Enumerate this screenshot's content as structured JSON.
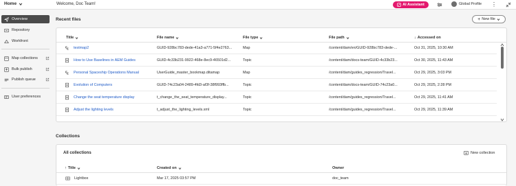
{
  "topbar": {
    "home_label": "Home",
    "welcome": "Welcome, Doc Team!",
    "ai_assistant": "AI Assistant",
    "profile": "Global Profile"
  },
  "sidebar": {
    "items": [
      {
        "label": "Overview",
        "icon": "overview-icon"
      },
      {
        "label": "Repository",
        "icon": "repository-icon"
      },
      {
        "label": "Workfront",
        "icon": "workfront-icon"
      },
      {
        "label": "Map collections",
        "icon": "map-collections-icon"
      },
      {
        "label": "Bulk publish",
        "icon": "bulk-publish-icon"
      },
      {
        "label": "Publish queue",
        "icon": "publish-queue-icon"
      },
      {
        "label": "User preferences",
        "icon": "user-preferences-icon"
      }
    ]
  },
  "recent": {
    "title": "Recent files",
    "new_file": "New file",
    "columns": {
      "title": "Title",
      "file_name": "File name",
      "file_type": "File type",
      "file_path": "File path",
      "accessed_on": "Accessed on"
    },
    "rows": [
      {
        "title": "testmap2",
        "file_name": "GUID-928bc783-dede-41a3-a771-5f4e2763...",
        "file_type": "Map",
        "file_path": "/content/dam/en/GUID-928bc783-dede-...",
        "accessed_on": "Oct 31, 2025, 10:30 AM"
      },
      {
        "title": "How to Use Baselines in AEM Guides",
        "file_name": "GUID-4c33b231-9922-468e-8ec9-46501d2...",
        "file_type": "Topic",
        "file_path": "/content/dam/docs-team/GUID-4c33b23...",
        "accessed_on": "Oct 30, 2025, 11:43 AM"
      },
      {
        "title": "Personal Spaceship Operations Manual",
        "file_name": "UserGuide_master_bookmap.ditamap",
        "file_type": "Map",
        "file_path": "/content/dam/guides_regression/Travel...",
        "accessed_on": "Oct 29, 2025, 3:03 PM"
      },
      {
        "title": "Evolution of Computers",
        "file_name": "GUID-74c23a04-2489-4fd3-af3f-38f993ffb...",
        "file_type": "Topic",
        "file_path": "/content/dam/docs-team/GUID-74c23a0...",
        "accessed_on": "Oct 29, 2025, 2:28 PM"
      },
      {
        "title": "Change the seat temperature display",
        "file_name": "t_change_the_seat_temperature_display...",
        "file_type": "Topic",
        "file_path": "/content/dam/guides_regression/Travel...",
        "accessed_on": "Oct 29, 2025, 11:41 AM"
      },
      {
        "title": "Adjust the lighting levels",
        "file_name": "t_adjust_the_lighting_levels.xml",
        "file_type": "Topic",
        "file_path": "/content/dam/guides_regression/Travel...",
        "accessed_on": "Oct 29, 2025, 11:39 AM"
      }
    ]
  },
  "collections": {
    "title": "Collections",
    "all": "All collections",
    "new_collection": "New collection",
    "columns": {
      "title": "Title",
      "created_on": "Created on",
      "owner": "Owner"
    },
    "rows": [
      {
        "title": "Lightbox",
        "created_on": "Mar 17, 2025 03:57 PM",
        "owner": "doc_team"
      }
    ]
  },
  "colors": {
    "accent": "#e3186d",
    "link": "#1f5bc7",
    "active_nav": "#4b4b4b"
  }
}
